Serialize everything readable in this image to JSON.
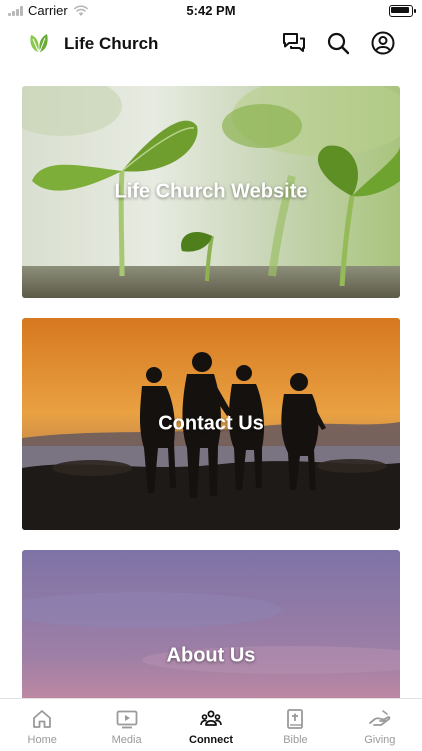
{
  "status_bar": {
    "carrier": "Carrier",
    "time": "5:42 PM"
  },
  "header": {
    "title": "Life Church",
    "icons": [
      "chat-bubbles-icon",
      "search-icon",
      "account-icon"
    ]
  },
  "cards": [
    {
      "label": "Life Church Website"
    },
    {
      "label": "Contact Us"
    },
    {
      "label": "About Us"
    }
  ],
  "tabs": [
    {
      "label": "Home",
      "icon": "home-icon",
      "active": false
    },
    {
      "label": "Media",
      "icon": "media-play-icon",
      "active": false
    },
    {
      "label": "Connect",
      "icon": "people-icon",
      "active": true
    },
    {
      "label": "Bible",
      "icon": "bible-icon",
      "active": false
    },
    {
      "label": "Giving",
      "icon": "giving-hand-icon",
      "active": false
    }
  ],
  "colors": {
    "accent": "#7cbf3a",
    "active_tab": "#111111",
    "inactive_tab": "#9a9a9a"
  }
}
